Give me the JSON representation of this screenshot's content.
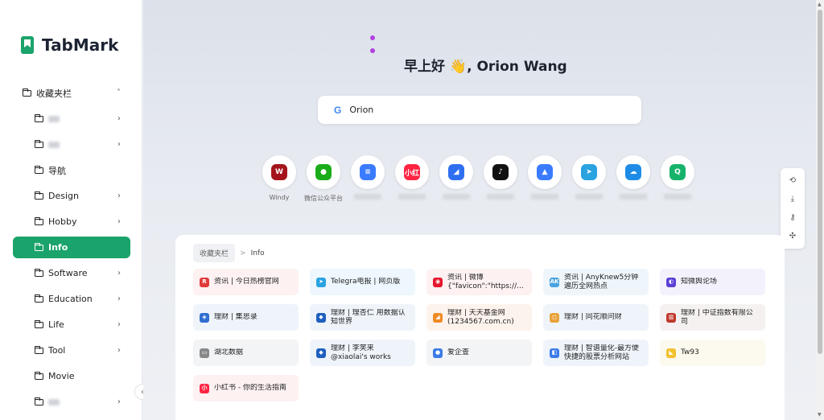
{
  "app": {
    "name": "TabMark",
    "brand_color": "#1aa36b"
  },
  "sidebar": {
    "items": [
      {
        "label": "收藏夹栏",
        "level": "root",
        "chevron": "˄",
        "blurred": false
      },
      {
        "label": "",
        "level": "child",
        "chevron": "›",
        "blurred": true
      },
      {
        "label": "",
        "level": "child",
        "chevron": "›",
        "blurred": true
      },
      {
        "label": "导航",
        "level": "child",
        "chevron": "",
        "blurred": false
      },
      {
        "label": "Design",
        "level": "child",
        "chevron": "›",
        "blurred": false
      },
      {
        "label": "Hobby",
        "level": "child",
        "chevron": "›",
        "blurred": false
      },
      {
        "label": "Info",
        "level": "child",
        "chevron": "",
        "blurred": false,
        "active": true
      },
      {
        "label": "Software",
        "level": "child",
        "chevron": "›",
        "blurred": false
      },
      {
        "label": "Education",
        "level": "child",
        "chevron": "›",
        "blurred": false
      },
      {
        "label": "Life",
        "level": "child",
        "chevron": "›",
        "blurred": false
      },
      {
        "label": "Tool",
        "level": "child",
        "chevron": "›",
        "blurred": false
      },
      {
        "label": "Movie",
        "level": "child",
        "chevron": "",
        "blurred": false
      },
      {
        "label": "",
        "level": "child",
        "chevron": "›",
        "blurred": true
      }
    ],
    "collapse_icon": "‹"
  },
  "greeting": "早上好 👋, Orion Wang",
  "search": {
    "value": "Orion",
    "engine_icon": "G"
  },
  "shortcuts": [
    {
      "label": "Windy",
      "icon": "windy-icon",
      "glyph": "W",
      "color": "#a3151b",
      "blurred": false
    },
    {
      "label": "微信公众平台",
      "icon": "wechat-icon",
      "glyph": "●",
      "color": "#1aad19",
      "blurred": false
    },
    {
      "label": "",
      "icon": "doc-icon",
      "glyph": "≡",
      "color": "#3a7bff",
      "blurred": true
    },
    {
      "label": "",
      "icon": "redbook-icon",
      "glyph": "小红",
      "color": "#ff2442",
      "blurred": true
    },
    {
      "label": "",
      "icon": "feishu-icon",
      "glyph": "◢",
      "color": "#2e6ff2",
      "blurred": true
    },
    {
      "label": "",
      "icon": "tiktok-icon",
      "glyph": "♪",
      "color": "#111111",
      "blurred": true
    },
    {
      "label": "",
      "icon": "lark-icon",
      "glyph": "▲",
      "color": "#3a7bff",
      "blurred": true
    },
    {
      "label": "",
      "icon": "telegram-icon",
      "glyph": "➤",
      "color": "#2aa3e0",
      "blurred": true
    },
    {
      "label": "",
      "icon": "cloud-icon",
      "glyph": "☁",
      "color": "#1e8ce6",
      "blurred": true
    },
    {
      "label": "",
      "icon": "refresh-icon",
      "glyph": "Q",
      "color": "#17b26a",
      "blurred": true
    }
  ],
  "floatbar": [
    {
      "icon": "history-icon",
      "glyph": "⟲"
    },
    {
      "icon": "download-icon",
      "glyph": "⤓"
    },
    {
      "icon": "key-icon",
      "glyph": "⚷"
    },
    {
      "icon": "puzzle-icon",
      "glyph": "✣"
    }
  ],
  "breadcrumb": {
    "root": "收藏夹栏",
    "separator": ">",
    "current": "Info"
  },
  "cards": [
    {
      "label": "资讯 | 今日热榜官网",
      "icon": "R",
      "icon_color": "#e03a3a",
      "bg": "#fdf1f2"
    },
    {
      "label": "Telegra电报 | 网页版",
      "icon": "➤",
      "icon_color": "#2aa3e0",
      "bg": "#edf7fd"
    },
    {
      "label": "资讯 | 微博 {\"favicon\":\"https://...",
      "icon": "◉",
      "icon_color": "#e6162d",
      "bg": "#fdf1f2"
    },
    {
      "label": "资讯 | AnyKnew5分钟遍历全网热点",
      "icon": "AK",
      "icon_color": "#4aa3df",
      "bg": "#eef6fc"
    },
    {
      "label": "知微舆论场",
      "icon": "◐",
      "icon_color": "#5b3fd6",
      "bg": "#f3f2fc"
    },
    {
      "label": "理财 | 集思录",
      "icon": "◈",
      "icon_color": "#2f6fd0",
      "bg": "#eff4fb"
    },
    {
      "label": "理财 | 理杏仁 用数据认知世界",
      "icon": "◆",
      "icon_color": "#1f5fbf",
      "bg": "#eff4fb"
    },
    {
      "label": "理财 | 天天基金网(1234567.com.cn)",
      "icon": "◢",
      "icon_color": "#f08a24",
      "bg": "#fdf3ed"
    },
    {
      "label": "理财 | 同花顺问财",
      "icon": "◻",
      "icon_color": "#e8a33a",
      "bg": "#eff4fb"
    },
    {
      "label": "理财 | 中证指数有限公司",
      "icon": "▥",
      "icon_color": "#c0392b",
      "bg": "#f5f1f1"
    },
    {
      "label": "湖北数据",
      "icon": "▭",
      "icon_color": "#888888",
      "bg": "#f3f4f6"
    },
    {
      "label": "理财 | 李笑来 @xiaolai's works",
      "icon": "◆",
      "icon_color": "#1f5fbf",
      "bg": "#eff4fb"
    },
    {
      "label": "爱企查",
      "icon": "●",
      "icon_color": "#3b7be8",
      "bg": "#f3f4f6"
    },
    {
      "label": "理财 | 智谱量化-最方便快捷的股票分析网站",
      "icon": "◧",
      "icon_color": "#3b7be8",
      "bg": "#eff4fb"
    },
    {
      "label": "Tw93",
      "icon": "◣",
      "icon_color": "#f2c12e",
      "bg": "#fcfaee"
    },
    {
      "label": "小红书 - 你的生活指南",
      "icon": "小",
      "icon_color": "#ff2442",
      "bg": "#fdf1f2"
    }
  ]
}
